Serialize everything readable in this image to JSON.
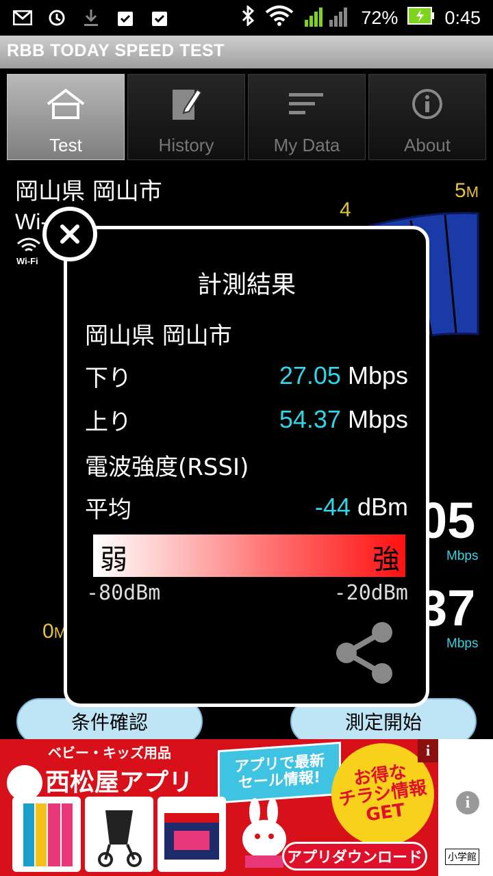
{
  "status": {
    "battery": "72%",
    "time": "0:45"
  },
  "app": {
    "title": "RBB TODAY SPEED TEST"
  },
  "tabs": [
    {
      "label": "Test",
      "icon": "home-icon",
      "active": true
    },
    {
      "label": "History",
      "icon": "edit-icon",
      "active": false
    },
    {
      "label": "My Data",
      "icon": "list-icon",
      "active": false
    },
    {
      "label": "About",
      "icon": "info-icon",
      "active": false
    }
  ],
  "background": {
    "location": "岡山県 岡山市",
    "connection": "Wi-",
    "wifi_label": "Wi-Fi",
    "gauge_ticks": {
      "t4": "4",
      "t5": "5",
      "t5_unit": "M",
      "t0": "0",
      "t0_unit": "M"
    },
    "down_digits": "05",
    "up_digits": "37",
    "unit": "Mbps"
  },
  "dialog": {
    "title": "計測結果",
    "location": "岡山県 岡山市",
    "download_label": "下り",
    "download_value": "27.05",
    "download_unit": "Mbps",
    "upload_label": "上り",
    "upload_value": "54.37",
    "upload_unit": "Mbps",
    "rssi_label": "電波強度(RSSI)",
    "avg_label": "平均",
    "avg_value": "-44",
    "avg_unit": "dBm",
    "bar_weak": "弱",
    "bar_strong": "強",
    "bar_min": "-80dBm",
    "bar_max": "-20dBm"
  },
  "buttons": {
    "conditions": "条件確認",
    "start": "測定開始"
  },
  "ad": {
    "subtitle": "ベビー・キッズ用品",
    "brand": "西松屋アプリ",
    "banner_line1": "アプリで最新",
    "banner_line2": "セール情報!",
    "burst_line1": "お得な",
    "burst_line2": "チラシ情報",
    "burst_line3": "GET",
    "download": "アプリダウンロード",
    "publisher": "小学館"
  },
  "colors": {
    "accent_value": "#2fd6e8",
    "gauge_tick": "#e6c23a",
    "button_fill": "#bfe4f6"
  }
}
